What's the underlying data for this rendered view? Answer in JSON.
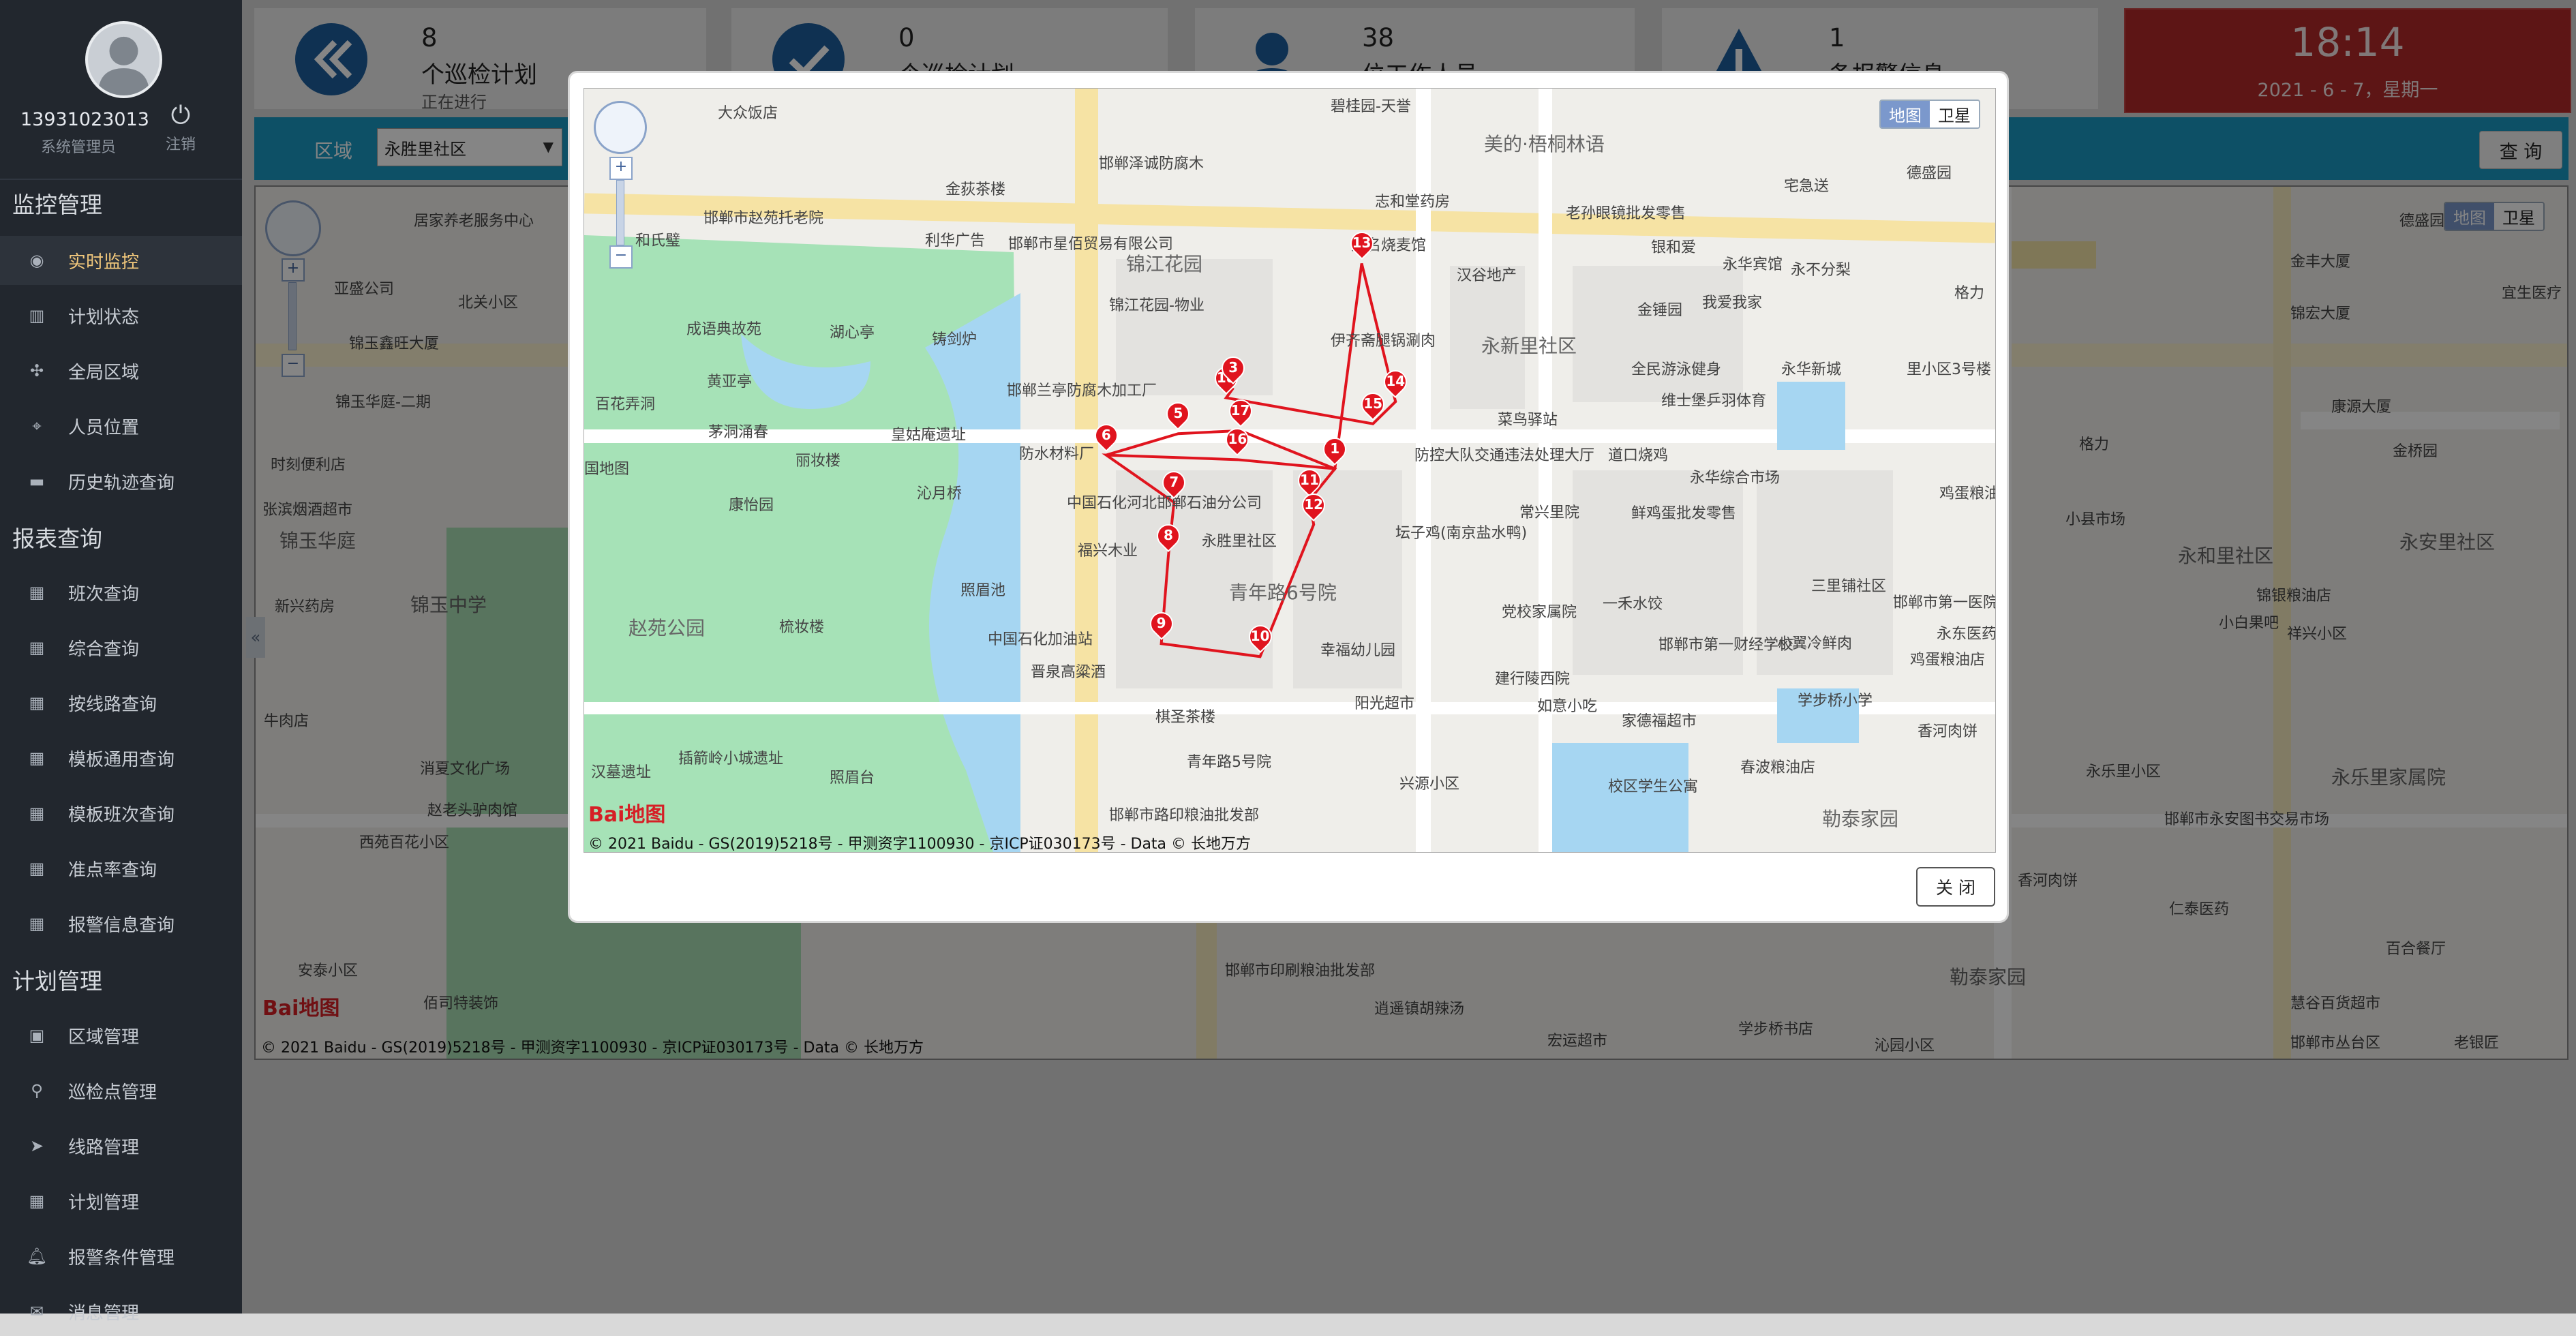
{
  "user": {
    "name": "13931023013",
    "role": "系统管理员",
    "logout_label": "注销"
  },
  "sidebar": {
    "sections": [
      {
        "title": "监控管理",
        "items": [
          {
            "label": "实时监控",
            "icon": "eye-icon",
            "active": true
          },
          {
            "label": "计划状态",
            "icon": "bar-chart-icon"
          },
          {
            "label": "全局区域",
            "icon": "arrows-icon"
          },
          {
            "label": "人员位置",
            "icon": "crosshair-icon"
          },
          {
            "label": "历史轨迹查询",
            "icon": "card-icon"
          }
        ]
      },
      {
        "title": "报表查询",
        "items": [
          {
            "label": "班次查询",
            "icon": "table-icon"
          },
          {
            "label": "综合查询",
            "icon": "table-icon"
          },
          {
            "label": "按线路查询",
            "icon": "table-icon"
          },
          {
            "label": "模板通用查询",
            "icon": "table-icon"
          },
          {
            "label": "模板班次查询",
            "icon": "table-icon"
          },
          {
            "label": "准点率查询",
            "icon": "table-icon"
          },
          {
            "label": "报警信息查询",
            "icon": "table-icon"
          }
        ]
      },
      {
        "title": "计划管理",
        "items": [
          {
            "label": "区域管理",
            "icon": "image-icon"
          },
          {
            "label": "巡检点管理",
            "icon": "map-pin-icon"
          },
          {
            "label": "线路管理",
            "icon": "send-icon"
          },
          {
            "label": "计划管理",
            "icon": "table-icon"
          },
          {
            "label": "报警条件管理",
            "icon": "bell-icon"
          },
          {
            "label": "消息管理",
            "icon": "message-icon"
          }
        ]
      }
    ]
  },
  "stats": [
    {
      "num": "8",
      "caption": "个巡检计划",
      "sub": "正在进行",
      "icon": "chevrons-left-icon"
    },
    {
      "num": "0",
      "caption": "个巡检计划",
      "sub": "",
      "icon": "check-icon"
    },
    {
      "num": "38",
      "caption": "位工作人员",
      "sub": "",
      "icon": "person-icon"
    },
    {
      "num": "1",
      "caption": "条报警信息",
      "sub": "",
      "icon": "warning-icon"
    }
  ],
  "clock": {
    "time": "18:14",
    "date": "2021 - 6 - 7，星期一"
  },
  "filter": {
    "area_label": "区域",
    "area_value": "永胜里社区",
    "query_label": "查 询"
  },
  "map": {
    "type_map": "地图",
    "type_satellite": "卫星",
    "logo": "Bai地图",
    "copyright": "© 2021 Baidu - GS(2019)5218号 - 甲测资字1100930 - 京ICP证030173号 - Data © 长地万方",
    "labels_bg": [
      "居家养老服务中心",
      "亚盛公司",
      "北关小区",
      "锦玉鑫旺大厦",
      "锦玉华庭-二期",
      "时刻便利店",
      "张滨烟酒超市",
      "锦玉华庭",
      "新兴药房",
      "锦玉中学",
      "牛肉店",
      "消夏文化广场",
      "赵老头驴肉馆",
      "西苑百花小区",
      "金丰大厦",
      "宜生医疗",
      "锦宏大厦",
      "德盛园",
      "康源大厦",
      "格力",
      "金桥园",
      "永安里社区",
      "永和里社区",
      "小县市场",
      "小白果吧",
      "锦银粮油店",
      "邯郸市永安图书交易市场",
      "永乐里家属院",
      "香河肉饼",
      "仁泰医药",
      "百合餐厅",
      "慧谷百货超市",
      "宏运超市",
      "邯郸市丛台区",
      "老银匠",
      "邯郸市印刷粮油批发部",
      "逍遥镇胡辣汤",
      "沁园小区",
      "学步桥书店",
      "勒泰家园",
      "安泰小区",
      "佰司特装饰",
      "祥兴小区",
      "永乐里小区"
    ],
    "labels_modal": [
      "大众饭店",
      "邯郸市赵苑托老院",
      "和氏璧",
      "金荻茶楼",
      "利华广告",
      "邯郸泽诚防腐木",
      "邯郸市星佰贸易有限公司",
      "锦江花园",
      "锦江花园-物业",
      "碧桂园-天誉",
      "美的·梧桐林语",
      "志和堂药房",
      "大名烧麦馆",
      "伊齐斋腿锅涮肉",
      "汉谷地产",
      "永新里社区",
      "老孙眼镜批发零售",
      "宅急送",
      "德盛园",
      "永华宾馆",
      "永不分梨",
      "我爱我家",
      "银和爱",
      "金锤园",
      "全民游泳健身",
      "维士堡乒羽体育",
      "永华新城",
      "菜鸟驿站",
      "里小区3号楼",
      "格力",
      "邯郸兰亭防腐木加工厂",
      "防水材料厂",
      "中国石化河北邯郸石油分公司",
      "永胜里社区",
      "福兴木业",
      "青年路6号院",
      "防控大队交通违法处理大厅",
      "坛子鸡(南京盐水鸭)",
      "常兴里院",
      "鲜鸡蛋批发零售",
      "永华综合市场",
      "道口烧鸡",
      "一禾水饺",
      "党校家属院",
      "三里铺社区",
      "中国石化加油站",
      "晋泉高粱酒",
      "棋圣茶楼",
      "幸福幼儿园",
      "邯郸市第一财经学校",
      "小翼冷鲜肉",
      "学步桥小学",
      "建行陵西院",
      "家德福超市",
      "如意小吃",
      "阳光超市",
      "青年路5号院",
      "兴源小区",
      "校区学生公寓",
      "春波粮油店",
      "香河肉饼",
      "勒泰家园",
      "邯郸市路印粮油批发部",
      "成语典故苑",
      "湖心亭",
      "铸剑炉",
      "百花弄洞",
      "黄亚亭",
      "茅洞涌春",
      "丽妆楼",
      "皇姑庵遗址",
      "沁月桥",
      "康怡园",
      "照眉池",
      "赵苑公园",
      "梳妆楼",
      "国地图",
      "汉墓遗址",
      "插箭岭小城遗址",
      "照眉台",
      "鸡蛋粮油店",
      "邯郸市第一医院健康体检科",
      "永东医药",
      "鸡蛋粮油店"
    ]
  },
  "modal": {
    "close_label": "关 闭"
  },
  "route": {
    "points": [
      {
        "n": "1",
        "x": 0.532,
        "y": 0.498
      },
      {
        "n": "5",
        "x": 0.421,
        "y": 0.452
      },
      {
        "n": "6",
        "x": 0.37,
        "y": 0.48
      },
      {
        "n": "7",
        "x": 0.418,
        "y": 0.542
      },
      {
        "n": "8",
        "x": 0.414,
        "y": 0.612
      },
      {
        "n": "9",
        "x": 0.409,
        "y": 0.727
      },
      {
        "n": "10",
        "x": 0.479,
        "y": 0.744
      },
      {
        "n": "11",
        "x": 0.514,
        "y": 0.539
      },
      {
        "n": "12",
        "x": 0.517,
        "y": 0.571
      },
      {
        "n": "13",
        "x": 0.551,
        "y": 0.229
      },
      {
        "n": "14",
        "x": 0.575,
        "y": 0.41
      },
      {
        "n": "15",
        "x": 0.559,
        "y": 0.439
      },
      {
        "n": "16",
        "x": 0.463,
        "y": 0.486
      },
      {
        "n": "17",
        "x": 0.465,
        "y": 0.448
      },
      {
        "n": "18",
        "x": 0.455,
        "y": 0.405
      },
      {
        "n": "3",
        "x": 0.46,
        "y": 0.392
      }
    ]
  }
}
